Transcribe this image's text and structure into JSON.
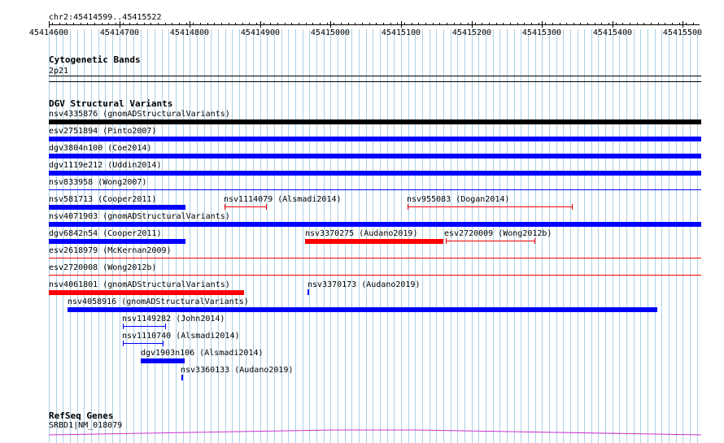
{
  "position_label": "chr2:45414599..45415522",
  "ruler": {
    "ticks": [
      "45414600",
      "45414700",
      "45414800",
      "45414900",
      "45415000",
      "45415100",
      "45415200",
      "45415300",
      "45415400",
      "45415500"
    ]
  },
  "cytoband": {
    "title": "Cytogenetic Bands",
    "band": "2p21"
  },
  "dgv": {
    "title": "DGV Structural Variants",
    "color_loss": "#ff0000",
    "color_gain": "#0000ff",
    "color_complex": "#000000",
    "variants": [
      {
        "id": "nsv4335876",
        "label": "nsv4335876 (gnomADStructuralVariants)"
      },
      {
        "id": "esv2751894",
        "label": "esv2751894 (Pinto2007)"
      },
      {
        "id": "dgv3804n100",
        "label": "dgv3804n100 (Coe2014)"
      },
      {
        "id": "dgv1119e212",
        "label": "dgv1119e212 (Uddin2014)"
      },
      {
        "id": "nsv833958",
        "label": "nsv833958 (Wong2007)"
      },
      {
        "id": "nsv581713",
        "label": "nsv581713 (Cooper2011)"
      },
      {
        "id": "nsv1114079",
        "label": "nsv1114079 (Alsmadi2014)"
      },
      {
        "id": "nsv955083",
        "label": "nsv955083 (Dogan2014)"
      },
      {
        "id": "nsv4071903",
        "label": "nsv4071903 (gnomADStructuralVariants)"
      },
      {
        "id": "dgv6842n54",
        "label": "dgv6842n54 (Cooper2011)"
      },
      {
        "id": "nsv3370275",
        "label": "nsv3370275 (Audano2019)"
      },
      {
        "id": "esv2720009",
        "label": "esv2720009 (Wong2012b)"
      },
      {
        "id": "esv2618979",
        "label": "esv2618979 (McKernan2009)"
      },
      {
        "id": "esv2720008",
        "label": "esv2720008 (Wong2012b)"
      },
      {
        "id": "nsv4061801",
        "label": "nsv4061801 (gnomADStructuralVariants)"
      },
      {
        "id": "nsv3370173",
        "label": "nsv3370173 (Audano2019)"
      },
      {
        "id": "nsv4058916",
        "label": "nsv4058916 (gnomADStructuralVariants)"
      },
      {
        "id": "nsv1149282",
        "label": "nsv1149282 (John2014)"
      },
      {
        "id": "nsv1110740",
        "label": "nsv1110740 (Alsmadi2014)"
      },
      {
        "id": "dgv1903n106",
        "label": "dgv1903n106 (Alsmadi2014)"
      },
      {
        "id": "nsv3360133",
        "label": "nsv3360133 (Audano2019)"
      }
    ]
  },
  "refseq": {
    "title": "RefSeq Genes",
    "gene": "SRBD1|NM_018079",
    "color": "#cc33cc"
  }
}
